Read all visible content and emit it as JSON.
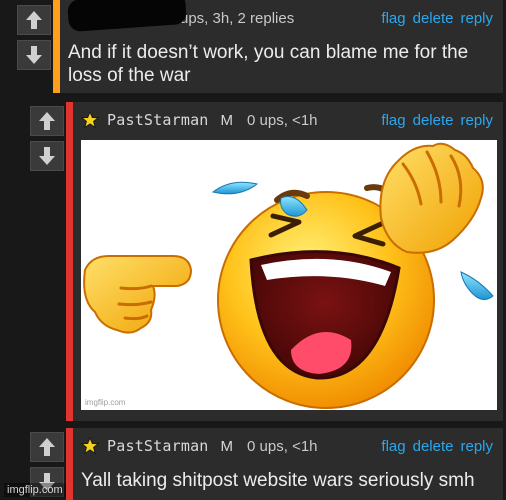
{
  "comments": [
    {
      "meta_stats": "ups, 3h, 2 replies",
      "body": "And if it doesn’t work, you can blame me for the loss of the war",
      "actions": [
        "flag",
        "delete",
        "reply"
      ]
    },
    {
      "username": "PastStarman",
      "gender": "M",
      "meta_stats": "0 ups, <1h",
      "actions": [
        "flag",
        "delete",
        "reply"
      ],
      "image_watermark": "imgflip.com"
    },
    {
      "username": "PastStarman",
      "gender": "M",
      "meta_stats": "0 ups, <1h",
      "body": "Yall taking shitpost website wars seriously smh",
      "actions": [
        "flag",
        "delete",
        "reply"
      ]
    }
  ],
  "footer": {
    "watermark": "imgflip.com"
  },
  "icons": {
    "upvote": "arrow-up-icon",
    "downvote": "arrow-down-icon",
    "user_badge": "star-badge-icon",
    "image_subject": "laughing-emoji-pointing"
  },
  "colors": {
    "background": "#181818",
    "comment_bg": "#2c2c2c",
    "top_comment_accent": "#ff9e1a",
    "reply_accent": "#e0342e",
    "link": "#2aa8ef",
    "text": "#ececec"
  }
}
